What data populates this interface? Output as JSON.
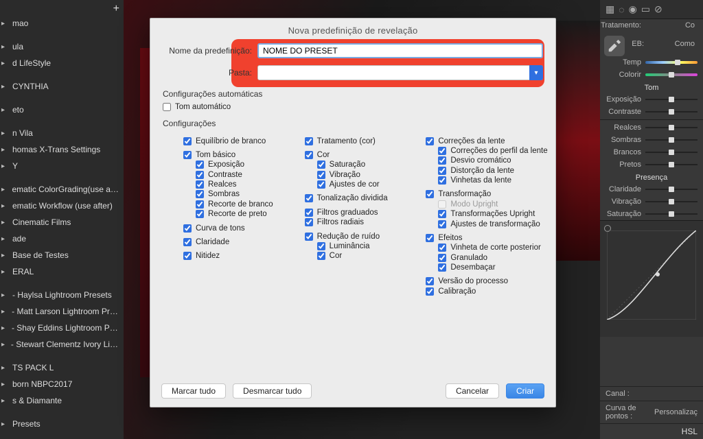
{
  "left_sidebar": {
    "items": [
      "mao",
      "",
      "ula",
      "d LifeStyle",
      "",
      "CYNTHIA",
      "",
      "eto",
      "",
      "n Vila",
      "homas X-Trans Settings",
      "Y",
      "",
      "ematic ColorGrading(use after)",
      "ematic Workflow (use after)",
      "Cinematic Films",
      "ade",
      "Base de Testes",
      "ERAL",
      "",
      "- Haylsa Lightroom Presets",
      "- Matt Larson Lightroom Presets",
      "- Shay Eddins Lightroom Presets",
      "- Stewart Clementz Ivory Lightroom…",
      "",
      "TS PACK L",
      "born NBPC2017",
      "s & Diamante",
      "",
      "Presets"
    ]
  },
  "right_panel": {
    "treatment": "Tratamento:",
    "treatment_val": "Co",
    "eb": "EB:",
    "eb_val": "Como",
    "sliders": [
      {
        "label": "Temp",
        "pos": 62
      },
      {
        "label": "Colorir",
        "pos": 50
      }
    ],
    "section_tom": "Tom",
    "tom_sliders": [
      {
        "label": "Exposição",
        "pos": 50
      },
      {
        "label": "Contraste",
        "pos": 50
      }
    ],
    "clip_sliders": [
      {
        "label": "Realces",
        "pos": 50
      },
      {
        "label": "Sombras",
        "pos": 50
      },
      {
        "label": "Brancos",
        "pos": 50
      },
      {
        "label": "Pretos",
        "pos": 50
      }
    ],
    "section_presenca": "Presença",
    "presenca_sliders": [
      {
        "label": "Claridade",
        "pos": 50
      },
      {
        "label": "Vibração",
        "pos": 50
      },
      {
        "label": "Saturação",
        "pos": 50
      }
    ],
    "channel_label": "Canal :",
    "curve_label": "Curva de pontos :",
    "curve_val": "Personalizaç",
    "hsl": "HSL"
  },
  "modal": {
    "title": "Nova predefinição de revelação",
    "name_label": "Nome da predefinição:",
    "name_value": "NOME DO PRESET",
    "folder_label": "Pasta:",
    "folder_value": "",
    "auto_title": "Configurações automáticas",
    "auto_check": "Tom automático",
    "settings_title": "Configurações",
    "col1": {
      "eq_branco": "Equilíbrio de branco",
      "tom_basico": "Tom básico",
      "exposicao": "Exposição",
      "contraste": "Contraste",
      "realces": "Realces",
      "sombras": "Sombras",
      "rec_branco": "Recorte de branco",
      "rec_preto": "Recorte de preto",
      "curva": "Curva de tons",
      "claridade": "Claridade",
      "nitidez": "Nitidez"
    },
    "col2": {
      "tratamento": "Tratamento (cor)",
      "cor": "Cor",
      "saturacao": "Saturação",
      "vibracao": "Vibração",
      "ajustes": "Ajustes de cor",
      "ton_div": "Tonalização dividida",
      "filt_grad": "Filtros graduados",
      "filt_rad": "Filtros radiais",
      "red_ruido": "Redução de ruído",
      "luminancia": "Luminância",
      "cor2": "Cor"
    },
    "col3": {
      "cor_lente": "Correções da lente",
      "perfil": "Correções do perfil da lente",
      "cromatico": "Desvio cromático",
      "distorcao": "Distorção da lente",
      "vinhetas": "Vinhetas da lente",
      "transform": "Transformação",
      "upright": "Modo Upright",
      "t_upright": "Transformações Upright",
      "ajustes_t": "Ajustes de transformação",
      "efeitos": "Efeitos",
      "vinheta_pc": "Vinheta de corte posterior",
      "granulado": "Granulado",
      "desembacar": "Desembaçar",
      "versao": "Versão do processo",
      "calib": "Calibração"
    },
    "buttons": {
      "mark_all": "Marcar tudo",
      "unmark_all": "Desmarcar tudo",
      "cancel": "Cancelar",
      "create": "Criar"
    }
  }
}
